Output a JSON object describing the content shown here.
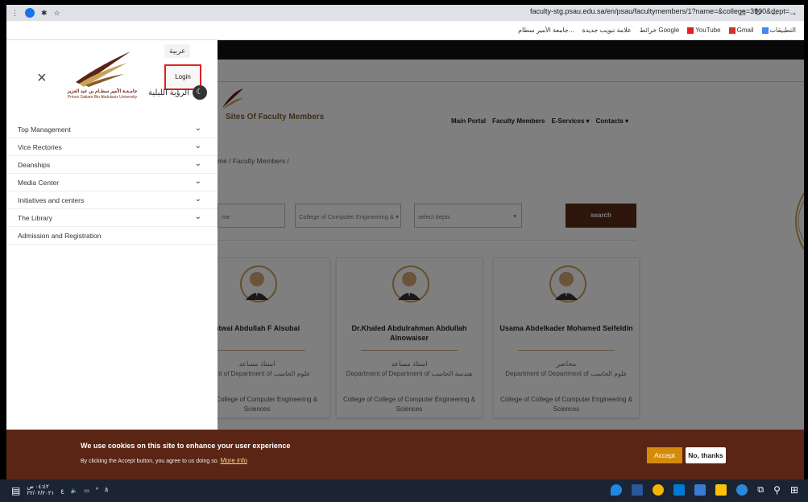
{
  "browser": {
    "url": "faculty-stg.psau.edu.sa/en/psau/facultymembers/1?name=&college=3900&dept=",
    "bookmarks": [
      "التطبيقات",
      "Gmail",
      "YouTube",
      "خرائط Google",
      "علامة تبويب جديدة",
      "جامعة الأمير سطام..."
    ]
  },
  "menu": {
    "lang": "عربية",
    "login": "Login",
    "night_mode": "الرؤية الليلية",
    "close": "×",
    "logo_ar": "جامـعـة الأمير سطـام بن عبد العزيز",
    "logo_en": "Prince Sattam Bin Abdulaziz University",
    "items": [
      {
        "label": "Top Management"
      },
      {
        "label": "Vice Rectories"
      },
      {
        "label": "Deanships"
      },
      {
        "label": "Media Center"
      },
      {
        "label": "Initiatives and centers"
      },
      {
        "label": "The Library"
      },
      {
        "label": "Admission and Registration"
      }
    ]
  },
  "site": {
    "title": "Sites Of Faculty Members",
    "nav": [
      "Main Portal",
      "Faculty Members",
      "E-Services ▾",
      "Contacts ▾"
    ],
    "breadcrumb": "me / Faculty Members /"
  },
  "filters": {
    "name_placeholder": "me",
    "college": "College of Computer Engineering & ▾",
    "dept": "select depts",
    "search_label": "search"
  },
  "cards": [
    {
      "name": "htwai Abdullah F Alsubai",
      "rank": "استاذ مساعد",
      "dept": "rtment of Department of علوم الحاسب",
      "college": "ege of College of Computer Engineering & Sciences"
    },
    {
      "name": "Dr.Khaled Abdulrahman Abdullah Alnowaiser",
      "rank": "استاذ مساعد",
      "dept": "Department of Department of هندسة الحاسب",
      "college": "College of College of Computer Engineering & Sciences"
    },
    {
      "name": "Usama Abdelkader Mohamed Seifeldin",
      "rank": "محاضر",
      "dept": "Department of Department of علوم الحاسب",
      "college": "College of College of Computer Engineering & Sciences"
    }
  ],
  "cookie": {
    "title": "We use cookies on this site to enhance your user experience",
    "sub": "By clicking the Accept button, you agree to us doing so.",
    "more": "More info",
    "accept": "Accept",
    "no_thanks": "No, thanks"
  },
  "taskbar": {
    "time": "٠٤:٤٢ ص",
    "date": "٢٢/٠٢/٢٠٢١",
    "lang": "ع"
  },
  "colors": {
    "brand_brown": "#5a2514",
    "accent_gold": "#d48b0c",
    "highlight_red": "#e02020"
  }
}
